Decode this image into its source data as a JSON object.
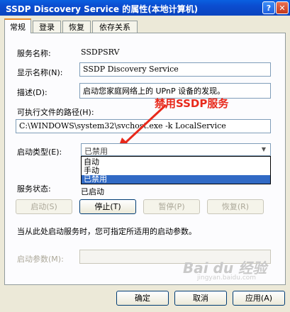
{
  "window": {
    "title": "SSDP Discovery Service 的属性(本地计算机)",
    "help_label": "?",
    "close_label": "✕"
  },
  "tabs": [
    {
      "label": "常规"
    },
    {
      "label": "登录"
    },
    {
      "label": "恢复"
    },
    {
      "label": "依存关系"
    }
  ],
  "general": {
    "service_name_label": "服务名称:",
    "service_name_value": "SSDPSRV",
    "display_name_label": "显示名称(N):",
    "display_name_value": "SSDP Discovery Service",
    "description_label": "描述(D):",
    "description_value": "启动您家庭网络上的 UPnP 设备的发现。",
    "path_label": "可执行文件的路径(H):",
    "path_value": "C:\\WINDOWS\\system32\\svchost.exe -k LocalService",
    "startup_type_label": "启动类型(E):",
    "startup_type_selected": "已禁用",
    "startup_options": [
      "自动",
      "手动",
      "已禁用"
    ],
    "status_label": "服务状态:",
    "status_value": "已启动",
    "start_button": "启动(S)",
    "stop_button": "停止(T)",
    "pause_button": "暂停(P)",
    "resume_button": "恢复(R)",
    "hint_text": "当从此处启动服务时，您可指定所适用的启动参数。",
    "start_params_label": "启动参数(M):",
    "start_params_value": ""
  },
  "annotation": {
    "text": "禁用SSDP服务",
    "color": "#e8291b"
  },
  "footer": {
    "ok_button": "确定",
    "cancel_button": "取消",
    "apply_button": "应用(A)"
  },
  "watermark": {
    "text": "Bai du 经验",
    "subtext": "jingyan.baidu.com"
  }
}
